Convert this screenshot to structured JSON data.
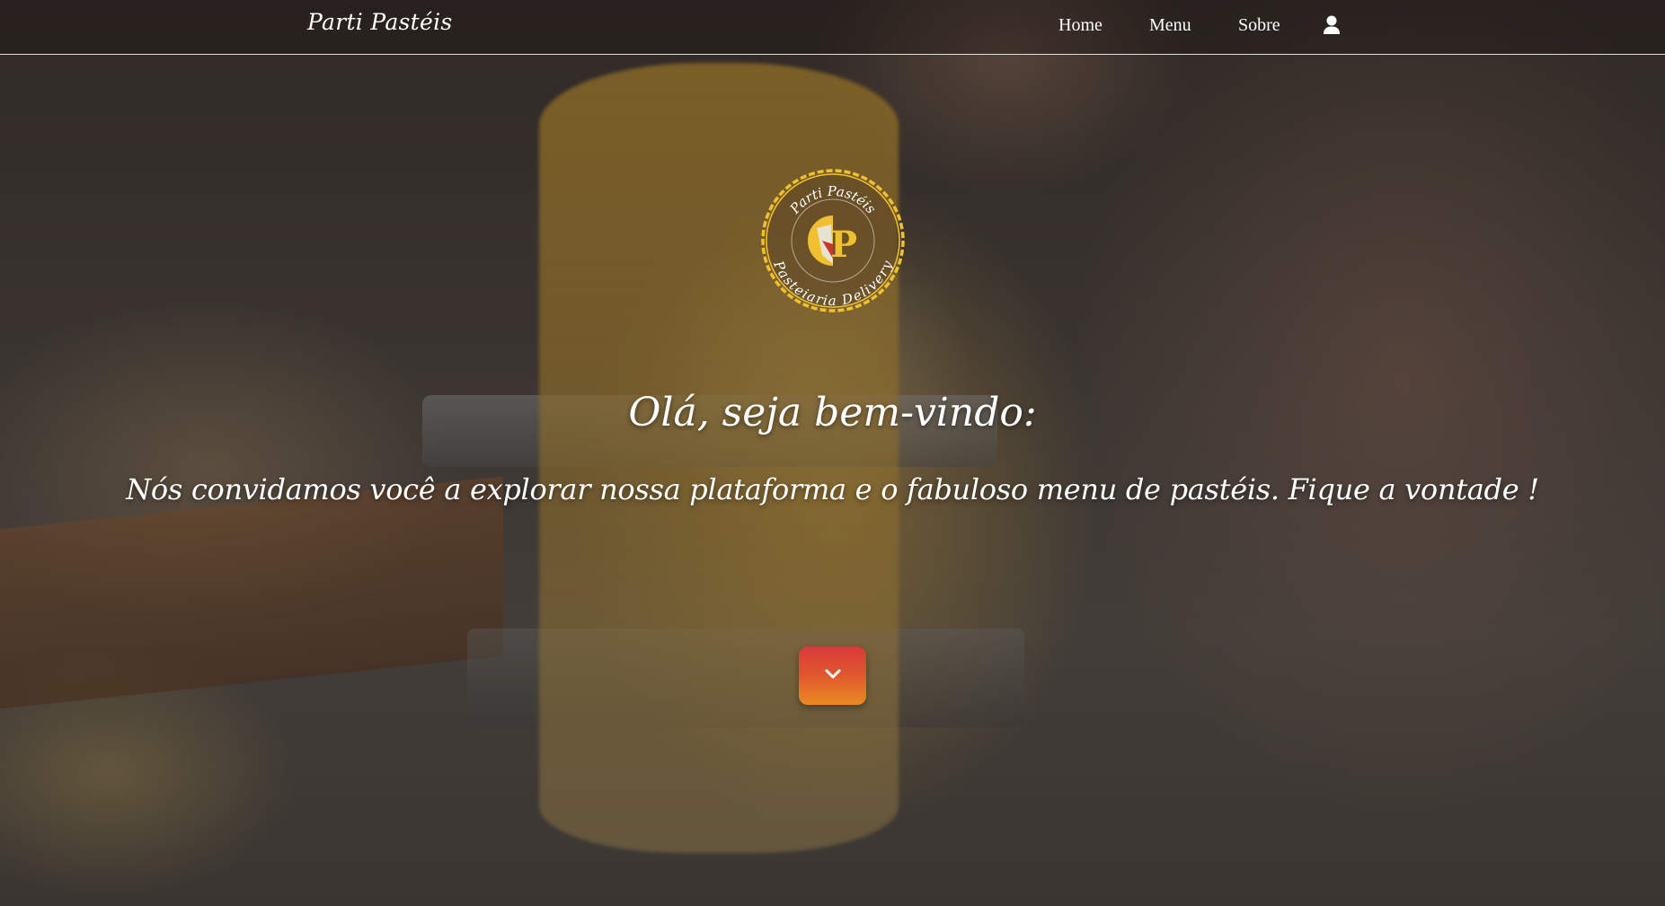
{
  "navbar": {
    "brand": "Parti Pastéis",
    "links": [
      {
        "label": "Home"
      },
      {
        "label": "Menu"
      },
      {
        "label": "Sobre"
      }
    ],
    "user_icon": "user-icon"
  },
  "logo": {
    "top_text": "Parti Pastéis",
    "bottom_text": "Pasteiaria Delivery",
    "monogram": "P"
  },
  "hero": {
    "welcome": "Olá, seja bem-vindo:",
    "subtitle": "Nós convidamos você a explorar nossa plataforma e o fabuloso menu de pastéis. Fique a vontade !",
    "scroll_icon": "chevron-down-icon"
  },
  "colors": {
    "accent_top": "#d8393a",
    "accent_bottom": "#eb8a22",
    "logo_gold": "#f0c030",
    "text": "#ffffff"
  }
}
